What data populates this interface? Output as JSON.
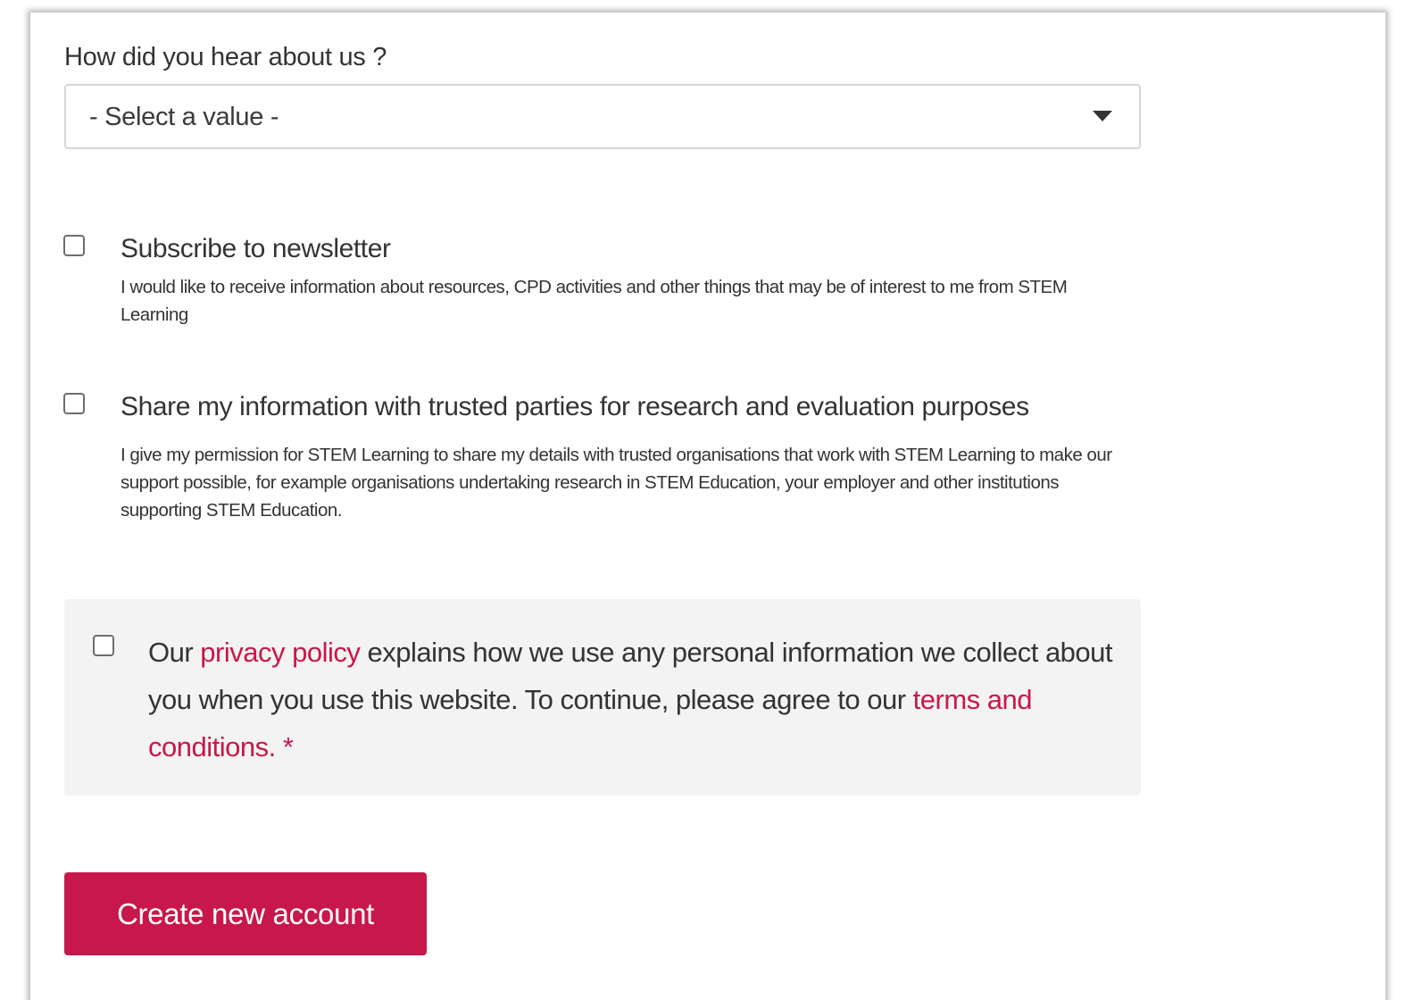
{
  "source": {
    "label": "How did you hear about us ?",
    "selected_value": "- Select a value -"
  },
  "newsletter": {
    "title": "Subscribe to newsletter",
    "description": "I would like to receive information about resources, CPD activities and other things that may be of interest to me from STEM Learning",
    "checked": false
  },
  "share_info": {
    "title": "Share my information with trusted parties for research and evaluation purposes",
    "description": "I give my permission for STEM Learning to share my details with trusted organisations that work with STEM Learning to make our support possible, for example organisations undertaking research in STEM Education, your employer and other institutions supporting STEM Education.",
    "checked": false
  },
  "privacy": {
    "prefix": "Our ",
    "privacy_link": "privacy policy",
    "middle": " explains how we use any personal information we collect about you when you use this website. To continue, please agree to our ",
    "terms_link": "terms and conditions.",
    "required_marker": "*",
    "checked": false
  },
  "submit": {
    "label": "Create new account"
  },
  "colors": {
    "accent": "#c8174a",
    "text": "#333333",
    "panel": "#f3f3f3"
  }
}
